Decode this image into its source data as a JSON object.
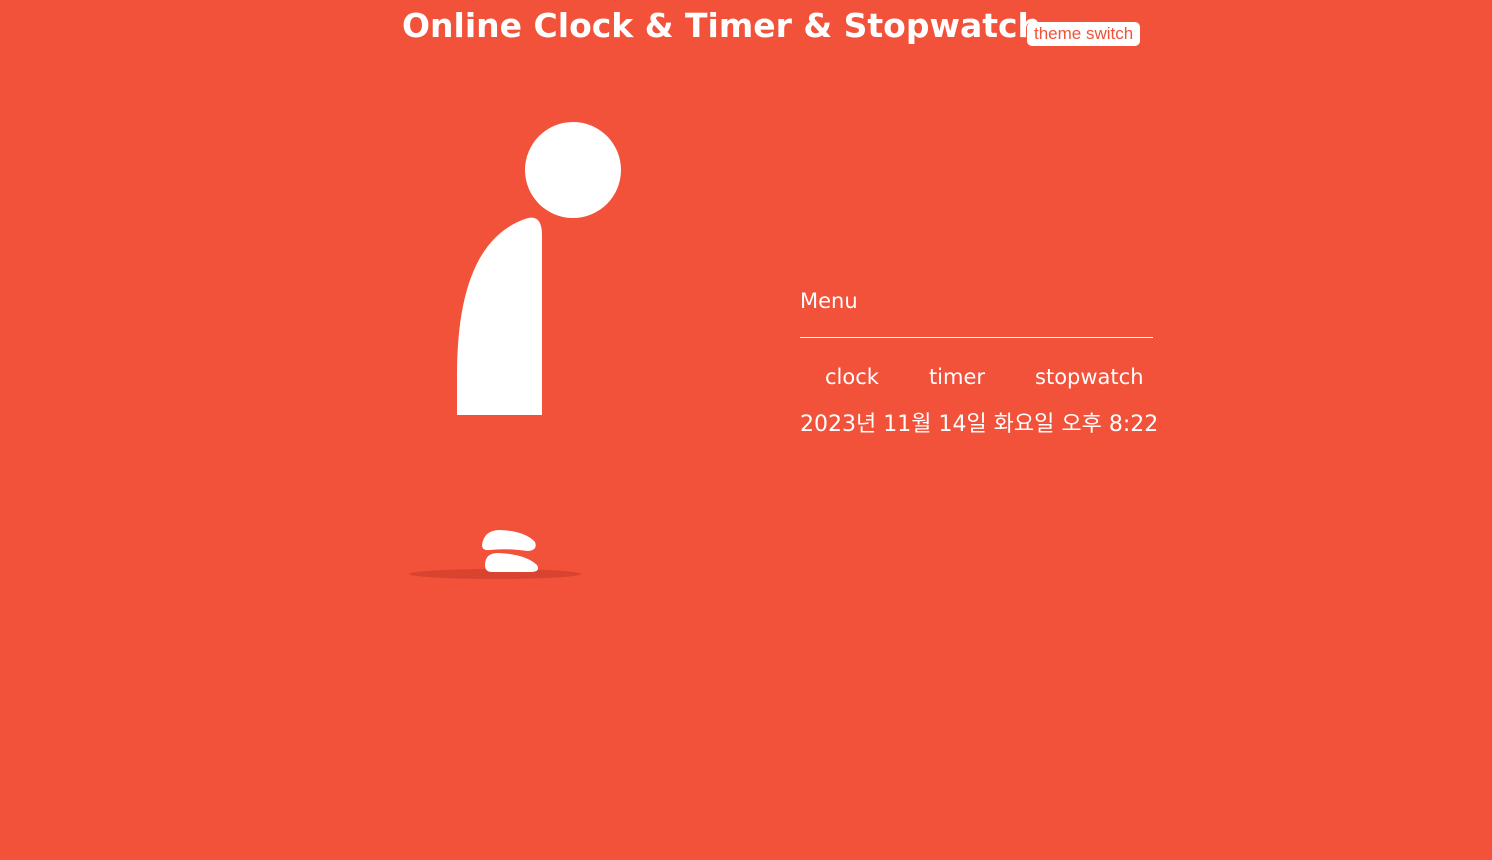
{
  "header": {
    "title": "Online Clock & Timer & Stopwatch",
    "theme_switch_label": "theme switch"
  },
  "menu": {
    "title": "Menu",
    "items": [
      {
        "label": "clock"
      },
      {
        "label": "timer"
      },
      {
        "label": "stopwatch"
      }
    ]
  },
  "datetime_text": "2023년 11월 14일 화요일 오후 8:22",
  "colors": {
    "background": "#f2513a",
    "foreground": "#ffffff",
    "shadow": "#d8442f"
  }
}
